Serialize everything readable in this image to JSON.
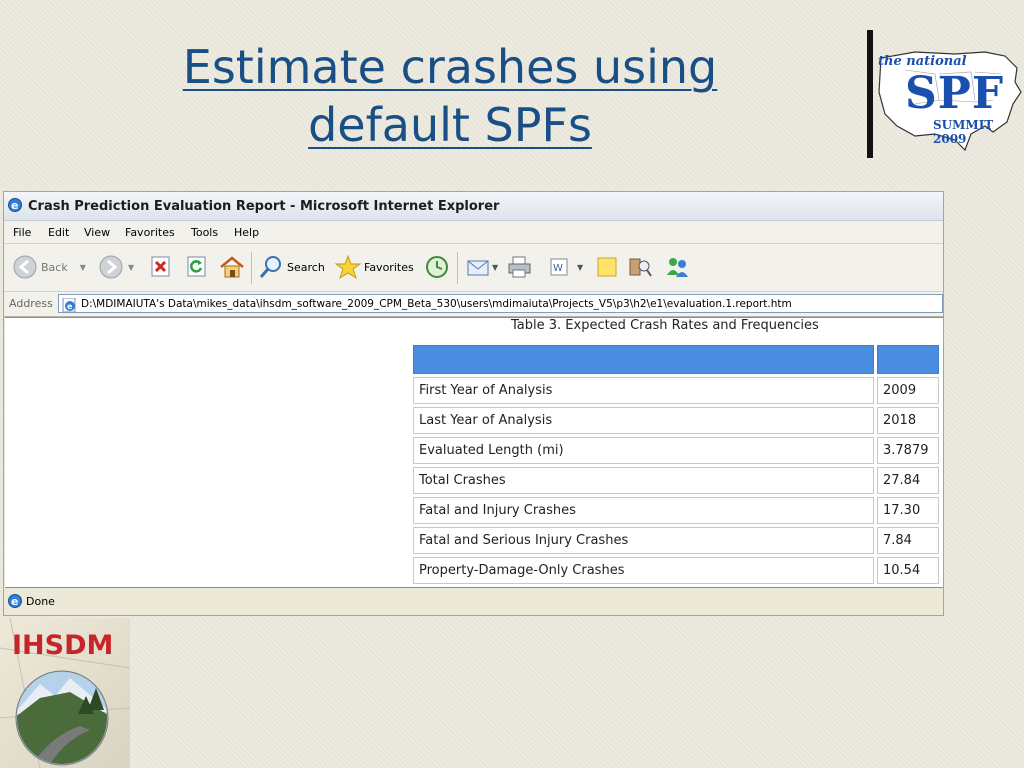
{
  "slide": {
    "title_line1": "Estimate crashes using",
    "title_line2": "default SPFs"
  },
  "spf_logo": {
    "line1": "the national",
    "line2": "SPF",
    "line3": "SUMMIT 2009"
  },
  "ihsdm_logo": {
    "text": "IHSDM"
  },
  "window": {
    "title": "Crash Prediction Evaluation Report - Microsoft Internet Explorer",
    "menu": [
      "File",
      "Edit",
      "View",
      "Favorites",
      "Tools",
      "Help"
    ],
    "toolbar": {
      "back_label": "Back",
      "search_label": "Search",
      "favorites_label": "Favorites"
    },
    "address": {
      "label": "Address",
      "value": "D:\\MDIMAIUTA's Data\\mikes_data\\ihsdm_software_2009_CPM_Beta_530\\users\\mdimaiuta\\Projects_V5\\p3\\h2\\e1\\evaluation.1.report.htm"
    },
    "status": "Done"
  },
  "report": {
    "caption": "Table 3.  Expected Crash Rates and Frequencies",
    "rows": [
      {
        "label": "First Year of Analysis",
        "value": "2009"
      },
      {
        "label": "Last Year of Analysis",
        "value": "2018"
      },
      {
        "label": "Evaluated Length (mi)",
        "value": "3.7879"
      },
      {
        "label": "Total Crashes",
        "value": "27.84"
      },
      {
        "label": "Fatal and Injury Crashes",
        "value": "17.30"
      },
      {
        "label": "Fatal and Serious Injury Crashes",
        "value": "7.84"
      },
      {
        "label": "Property-Damage-Only Crashes",
        "value": "10.54"
      }
    ]
  },
  "colors": {
    "title": "#1a4f86",
    "table_header": "#4a8de0",
    "ihsdm_red": "#c6262b",
    "spf_blue": "#1a4fb0"
  }
}
